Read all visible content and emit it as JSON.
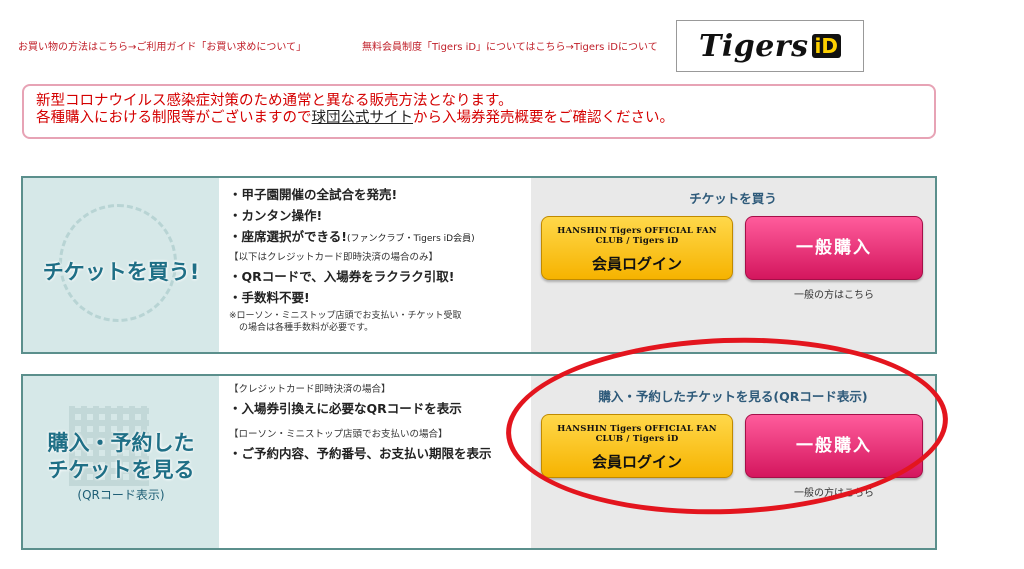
{
  "top_links": {
    "guide": "お買い物の方法はこちら→ご利用ガイド「お買い求めについて」",
    "membership": "無料会員制度「Tigers iD」についてはこちら→Tigers iDについて"
  },
  "logo": {
    "word": "Tigers",
    "id": "iD"
  },
  "notice": {
    "line1": "新型コロナウイルス感染症対策のため通常と異なる販売方法となります。",
    "line2_before": "各種購入における制限等がございますので",
    "line2_link": "球団公式サイト",
    "line2_after": "から入場券発売概要をご確認ください。"
  },
  "buy_panel": {
    "title": "チケットを買う!",
    "features": [
      "・甲子園開催の全試合を発売!",
      "・カンタン操作!",
      "・座席選択ができる!"
    ],
    "feature_note": "(ファンクラブ・Tigers iD会員)",
    "qr_bracket": "【以下はクレジットカード即時決済の場合のみ】",
    "qr_features": [
      "・QRコードで、入場券をラクラク引取!",
      "・手数料不要!"
    ],
    "note_line1": "※ローソン・ミニストップ店頭でお支払い・チケット受取",
    "note_line2": "の場合は各種手数料が必要です。",
    "heading": "チケットを買う",
    "member_club": "HANSHIN Tigers OFFICIAL FAN CLUB / Tigers iD",
    "member_label": "会員ログイン",
    "general_label": "一般購入",
    "general_caption": "一般の方はこちら"
  },
  "view_panel": {
    "title_line1": "購入・予約した",
    "title_line2": "チケットを見る",
    "qr_note": "(QRコード表示)",
    "bracket1": "【クレジットカード即時決済の場合】",
    "feature1": "・入場券引換えに必要なQRコードを表示",
    "bracket2": "【ローソン・ミニストップ店頭でお支払いの場合】",
    "feature2": "・ご予約内容、予約番号、お支払い期限を表示",
    "heading": "購入・予約したチケットを見る(QRコード表示)",
    "member_club": "HANSHIN Tigers OFFICIAL FAN CLUB / Tigers iD",
    "member_label": "会員ログイン",
    "general_label": "一般購入",
    "general_caption": "一般の方はこちら"
  },
  "colors": {
    "accent_red": "#e3151e",
    "panel_border": "#5b8f8c",
    "member_yellow": "#f6b300",
    "general_pink": "#d4165e"
  }
}
